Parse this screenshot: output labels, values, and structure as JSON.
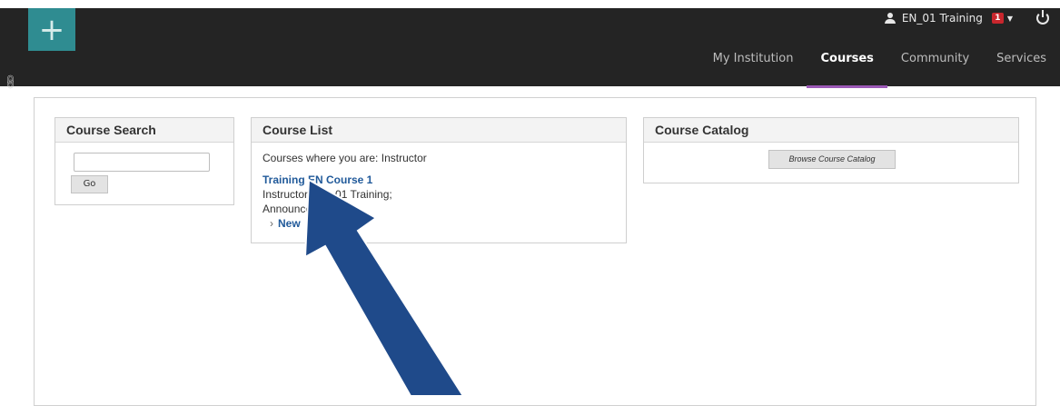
{
  "header": {
    "logo_icon": "plus-icon",
    "link_icon": "link-icon",
    "user_name": "EN_01 Training",
    "notification_count": "1",
    "nav_tabs": [
      "My Institution",
      "Courses",
      "Community",
      "Services"
    ],
    "active_tab": "Courses",
    "accent_color": "#9b59b6"
  },
  "course_search": {
    "title": "Course Search",
    "input_value": "",
    "go_label": "Go"
  },
  "course_list": {
    "title": "Course List",
    "role_text": "Courses where you are: Instructor",
    "course_name": "Training EN Course 1",
    "instructor": "Instructor: EN_01 Training;",
    "announcements_label": "Announcements:",
    "announcement_item": "New"
  },
  "course_catalog": {
    "title": "Course Catalog",
    "browse_label": "Browse Course Catalog"
  },
  "annotation": {
    "arrow_color": "#1f4a8a"
  }
}
